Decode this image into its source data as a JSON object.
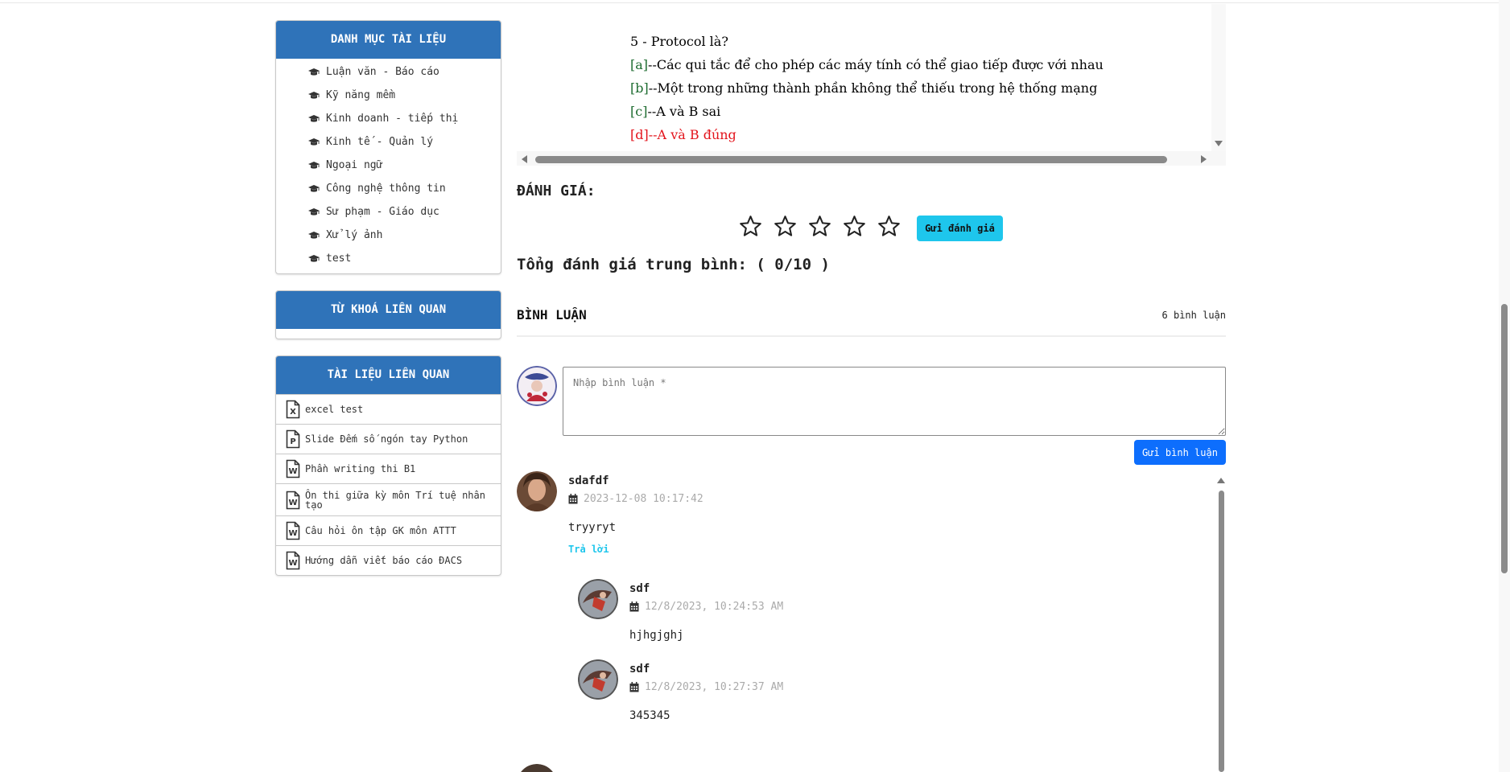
{
  "sidebar": {
    "categories": {
      "title": "DANH MỤC TÀI LIỆU",
      "items": [
        "Luận văn - Báo cáo",
        "Kỹ năng mềm",
        "Kinh doanh - tiếp thị",
        "Kinh tế - Quản lý",
        "Ngoại ngữ",
        "Công nghệ thông tin",
        "Sư phạm - Giáo dục",
        "Xử lý ảnh",
        "test"
      ]
    },
    "keywords": {
      "title": "TỪ KHOÁ LIÊN QUAN"
    },
    "related": {
      "title": "TÀI LIỆU LIÊN QUAN",
      "items": [
        {
          "type": "X",
          "label": "excel test"
        },
        {
          "type": "P",
          "label": "Slide Đếm số ngón tay Python"
        },
        {
          "type": "W",
          "label": "Phần writing thi B1"
        },
        {
          "type": "W",
          "label": "Ôn thi giữa kỳ môn Trí tuệ nhân tạo"
        },
        {
          "type": "W",
          "label": "Câu hỏi ôn tập GK môn ATTT"
        },
        {
          "type": "W",
          "label": "Hướng dẫn viết báo cáo ĐACS"
        }
      ]
    }
  },
  "quiz": {
    "question": "5 - Protocol là?",
    "options": [
      {
        "key": "[a]",
        "text": "--Các qui tắc để cho phép các máy tính có thể giao tiếp được với nhau"
      },
      {
        "key": "[b]",
        "text": "--Một trong những thành phần không thể thiếu trong hệ thống mạng"
      },
      {
        "key": "[c]",
        "text": "--A và B sai"
      },
      {
        "key": "[d]",
        "text": "--A và B đúng"
      }
    ],
    "correct_color": "#e3131b"
  },
  "rating": {
    "title": "ĐÁNH GIÁ:",
    "stars_selected": 0,
    "stars_total": 5,
    "submit_label": "Gửi đánh giá",
    "avg_prefix": "Tổng đánh giá trung bình: ( ",
    "avg_value": "0/10",
    "avg_suffix": " )"
  },
  "comments": {
    "title": "BÌNH LUẬN",
    "count": "6 bình luận",
    "input_placeholder": "Nhập bình luận *",
    "send_label": "Gửi bình luận",
    "items": [
      {
        "name": "sdafdf",
        "time": "2023-12-08 10:17:42",
        "body": "tryyryt",
        "reply": "Trả lời"
      },
      {
        "name": "sdf",
        "time": "12/8/2023, 10:24:53 AM",
        "body": "hjhgjghj"
      },
      {
        "name": "sdf",
        "time": "12/8/2023, 10:27:37 AM",
        "body": "345345"
      }
    ]
  },
  "colors": {
    "header_blue": "#2f73b9",
    "cyan": "#1ec6ec",
    "primary": "#0d6efd",
    "option_key_green": "#1d6b2f"
  }
}
